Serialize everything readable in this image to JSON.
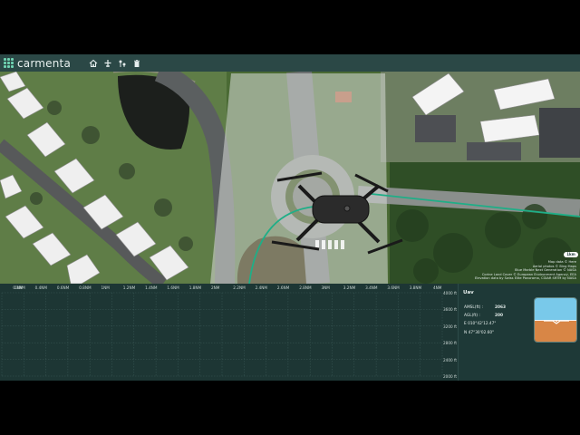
{
  "app": {
    "logo_text": "carmenta",
    "accent": "#6fd3b2"
  },
  "toolbar": {
    "tools": [
      {
        "name": "home-icon",
        "glyph": "⌂"
      },
      {
        "name": "aircraft-icon",
        "glyph": "✈"
      },
      {
        "name": "waypoints-icon",
        "glyph": "⚲"
      },
      {
        "name": "trash-icon",
        "glyph": "🗑"
      }
    ]
  },
  "map": {
    "scale_badge": "1km",
    "attribution": [
      "Map data © Here",
      "Aerial photos © Bing Maps",
      "Blue Marble Next Generation © NASA",
      "Corine Land Cover © European Environment Agency, EEA",
      "Elevation data by Swiss Elite Panorama, CGIAR SRTM by NASA"
    ]
  },
  "profile": {
    "range_labels": [
      "0NM",
      "0.2NM",
      "0.4NM",
      "0.6NM",
      "0.8NM",
      "1NM",
      "1.2NM",
      "1.4NM",
      "1.6NM",
      "1.8NM",
      "2NM",
      "2.2NM",
      "2.4NM",
      "2.6NM",
      "2.8NM",
      "3NM",
      "3.2NM",
      "3.4NM",
      "3.6NM",
      "3.8NM",
      "4NM"
    ],
    "altitude_labels": [
      "4000 ft",
      "3600 ft",
      "3200 ft",
      "2800 ft",
      "2400 ft",
      "2000 ft"
    ]
  },
  "info": {
    "title": "Uav",
    "rows": [
      {
        "label": "AMSL(ft) :",
        "value": "2063"
      },
      {
        "label": "AGL(ft) :",
        "value": "200"
      },
      {
        "label": "E 010°42'12.47\"",
        "value": ""
      },
      {
        "label": "N 47°30'02.60\"",
        "value": ""
      }
    ],
    "attitude": {
      "sky_color": "#79c9ea",
      "ground_color": "#d88646"
    }
  }
}
